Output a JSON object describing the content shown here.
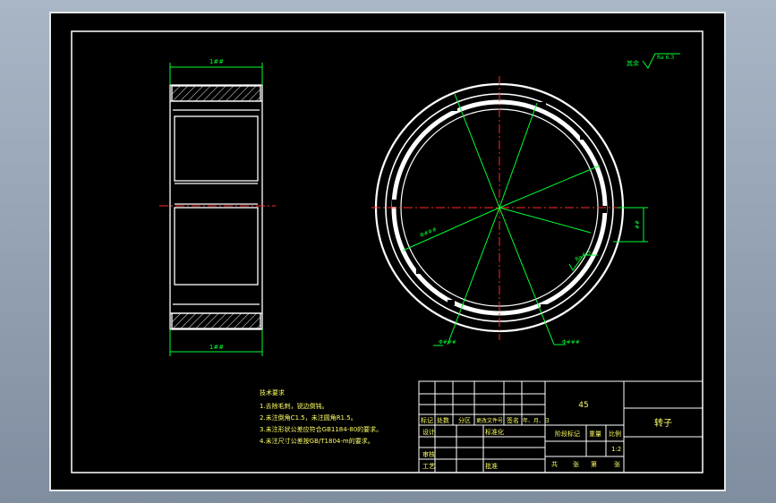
{
  "viewport": {
    "background": "#000000",
    "window_background": "#9aa8b9"
  },
  "colors": {
    "frame": "#ffffff",
    "centerline": "#ff2a2a",
    "dimension": "#00ff33",
    "notes": "#ffff66"
  },
  "dimensions": {
    "top_width": "1##",
    "bottom_width": "1##",
    "left_diameter": "Φ###",
    "right_diameter": "Φ###",
    "dia_label_1": "Φ###",
    "dia_label_2": "Φ###",
    "side_dim": "##"
  },
  "surface": {
    "global_note": "其余",
    "global_roughness": "Ra 6.3",
    "local_roughness": "Ra 6.3"
  },
  "notes": {
    "heading": "技术要求",
    "items": [
      "1.去除毛刺，锐边倒钝。",
      "2.未注倒角C1.5，未注圆角R1.5。",
      "3.未注形状公差应符合GB1184-80的要求。",
      "4.未注尺寸公差按GB/T1804-m的要求。"
    ]
  },
  "title_block": {
    "material": "45",
    "part_name": "转子",
    "row_headers": [
      "标记",
      "处数",
      "分区",
      "更改文件号",
      "签名",
      "年、月、日"
    ],
    "designer": "设计",
    "standardization": "标准化",
    "reviewer": "审核",
    "process": "工艺",
    "approve": "批准",
    "stage_label": "阶段标记",
    "weight_label": "重量",
    "scale_label": "比例",
    "scale": "1:2",
    "sheet_total": "共",
    "sheet_label": "张",
    "sheet_no": "第",
    "sheet_label2": "张"
  }
}
